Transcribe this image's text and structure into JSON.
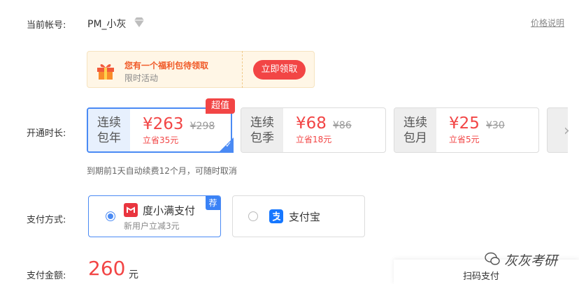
{
  "account": {
    "label": "当前帐号:",
    "name": "PM_小灰"
  },
  "price_info_link": "价格说明",
  "gift": {
    "title": "您有一个福利包待领取",
    "subtitle": "限时活动",
    "button": "立即领取"
  },
  "duration": {
    "label": "开通时长:",
    "note": "到期前1天自动续费12个月，可随时取消",
    "badge": "超值",
    "plans": [
      {
        "name": "连续包年",
        "price": "¥263",
        "original": "¥298",
        "save": "立省35元",
        "selected": true
      },
      {
        "name": "连续包季",
        "price": "¥68",
        "original": "¥86",
        "save": "立省18元",
        "selected": false
      },
      {
        "name": "连续包月",
        "price": "¥25",
        "original": "¥30",
        "save": "立省5元",
        "selected": false
      }
    ]
  },
  "payment": {
    "label": "支付方式:",
    "recommend_badge": "荐",
    "methods": [
      {
        "name": "度小满支付",
        "note": "新用户立减3元",
        "selected": true
      },
      {
        "name": "支付宝",
        "note": "",
        "selected": false
      }
    ]
  },
  "amount": {
    "label": "支付金额:",
    "value": "260",
    "unit": "元"
  },
  "scan_pay": "扫码支付",
  "watermark": "灰灰考研",
  "colors": {
    "accent_red": "#f24545",
    "accent_blue": "#4a8af4"
  }
}
